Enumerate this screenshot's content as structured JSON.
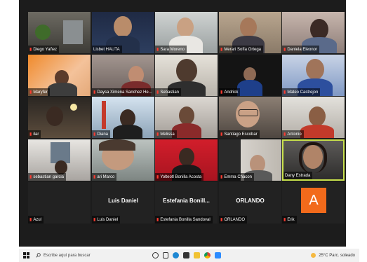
{
  "participants": [
    {
      "name": "Diego Yañez",
      "muted": true
    },
    {
      "name": "Lisbet HAUTA",
      "muted": false
    },
    {
      "name": "Sara Moreno",
      "muted": true
    },
    {
      "name": "Merari Sofía Ortega",
      "muted": true
    },
    {
      "name": "Daniela Eleonor",
      "muted": true
    },
    {
      "name": "Maryfer",
      "muted": true
    },
    {
      "name": "Daysa Ximena Sanchez He...",
      "muted": true
    },
    {
      "name": "Sebastian",
      "muted": true
    },
    {
      "name": "Andrick",
      "muted": true
    },
    {
      "name": "Mateo Castrejon",
      "muted": true
    },
    {
      "name": "ilar",
      "muted": true
    },
    {
      "name": "Diana",
      "muted": true
    },
    {
      "name": "Melissa",
      "muted": true
    },
    {
      "name": "Santiago Escobar",
      "muted": true
    },
    {
      "name": "Antonio",
      "muted": true
    },
    {
      "name": "sebastian garcia",
      "muted": true
    },
    {
      "name": "ari Marco",
      "muted": true
    },
    {
      "name": "Yolteotl Bonilla Acosta",
      "muted": true
    },
    {
      "name": "Emma Chacon",
      "muted": true
    },
    {
      "name": "Dany Estrada",
      "muted": false
    },
    {
      "name": "Azul",
      "muted": true
    },
    {
      "name": "Luis Daniel",
      "muted": true,
      "center_label": "Luis Daniel"
    },
    {
      "name": "Estefania Bonilla Sandoval",
      "muted": true,
      "center_label": "Estefania  Bonill..."
    },
    {
      "name": "ORLANDO",
      "muted": true,
      "center_label": "ORLANDO"
    },
    {
      "name": "Erik",
      "muted": true,
      "avatar_letter": "A"
    }
  ],
  "colors": {
    "active_speaker_border": "#c8e04c",
    "avatar_bg": "#f26a1b",
    "muted_icon": "#ff3b30"
  },
  "taskbar": {
    "search_placeholder": "Escribe aquí para buscar",
    "weather": "25°C  Parc. soleado",
    "icons": [
      "windows-icon",
      "search-icon",
      "task-view-icon",
      "widgets-icon",
      "edge-icon",
      "store-icon",
      "file-explorer-icon",
      "chrome-icon",
      "zoom-icon",
      "weather-icon"
    ]
  }
}
